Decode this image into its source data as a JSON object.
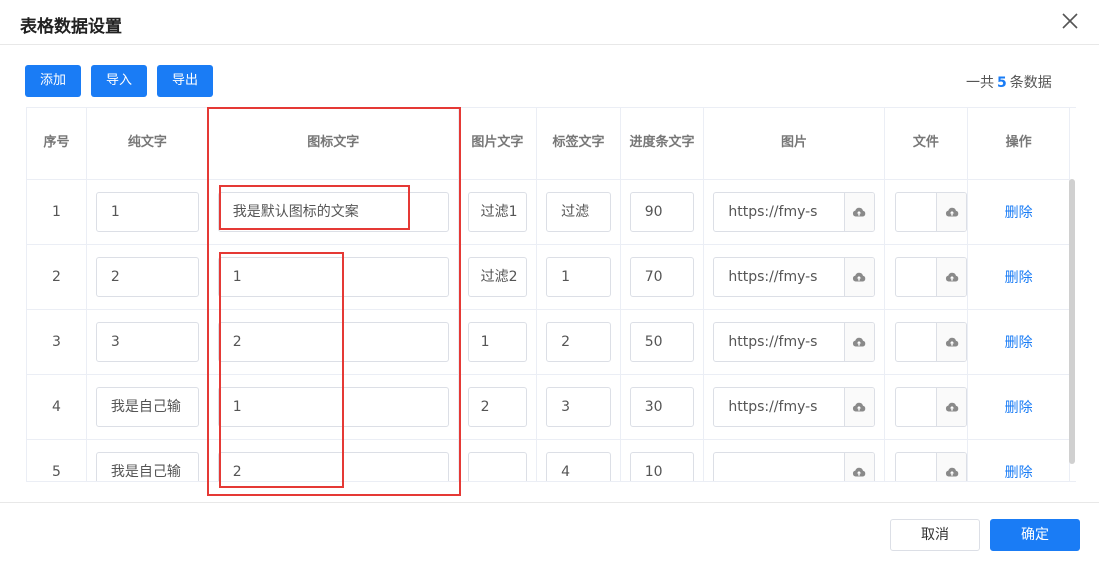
{
  "dialog": {
    "title": "表格数据设置"
  },
  "toolbar": {
    "add_label": "添加",
    "import_label": "导入",
    "export_label": "导出"
  },
  "summary": {
    "prefix": "一共",
    "count": "5",
    "suffix": "条数据"
  },
  "table": {
    "headers": [
      "序号",
      "纯文字",
      "图标文字",
      "图片文字",
      "标签文字",
      "进度条文字",
      "图片",
      "文件",
      "操作"
    ],
    "rows": [
      {
        "index": "1",
        "plain": "1",
        "icon_text": "我是默认图标的文案",
        "image_text": "过滤1",
        "tag_text": "过滤",
        "progress": "90",
        "image": "https://fmy-s",
        "file": "",
        "action": "删除"
      },
      {
        "index": "2",
        "plain": "2",
        "icon_text": "1",
        "image_text": "过滤2",
        "tag_text": "1",
        "progress": "70",
        "image": "https://fmy-s",
        "file": "",
        "action": "删除"
      },
      {
        "index": "3",
        "plain": "3",
        "icon_text": "2",
        "image_text": "1",
        "tag_text": "2",
        "progress": "50",
        "image": "https://fmy-s",
        "file": "",
        "action": "删除"
      },
      {
        "index": "4",
        "plain": "我是自己输",
        "icon_text": "1",
        "image_text": "2",
        "tag_text": "3",
        "progress": "30",
        "image": "https://fmy-s",
        "file": "",
        "action": "删除"
      },
      {
        "index": "5",
        "plain": "我是自己输",
        "icon_text": "2",
        "image_text": "",
        "tag_text": "4",
        "progress": "10",
        "image": "",
        "file": "",
        "action": "删除"
      }
    ]
  },
  "footer": {
    "cancel_label": "取消",
    "confirm_label": "确定"
  },
  "colors": {
    "primary": "#1a7cf5",
    "highlight": "#e53935"
  },
  "icons": {
    "close": "close-icon",
    "upload": "cloud-upload-icon"
  }
}
